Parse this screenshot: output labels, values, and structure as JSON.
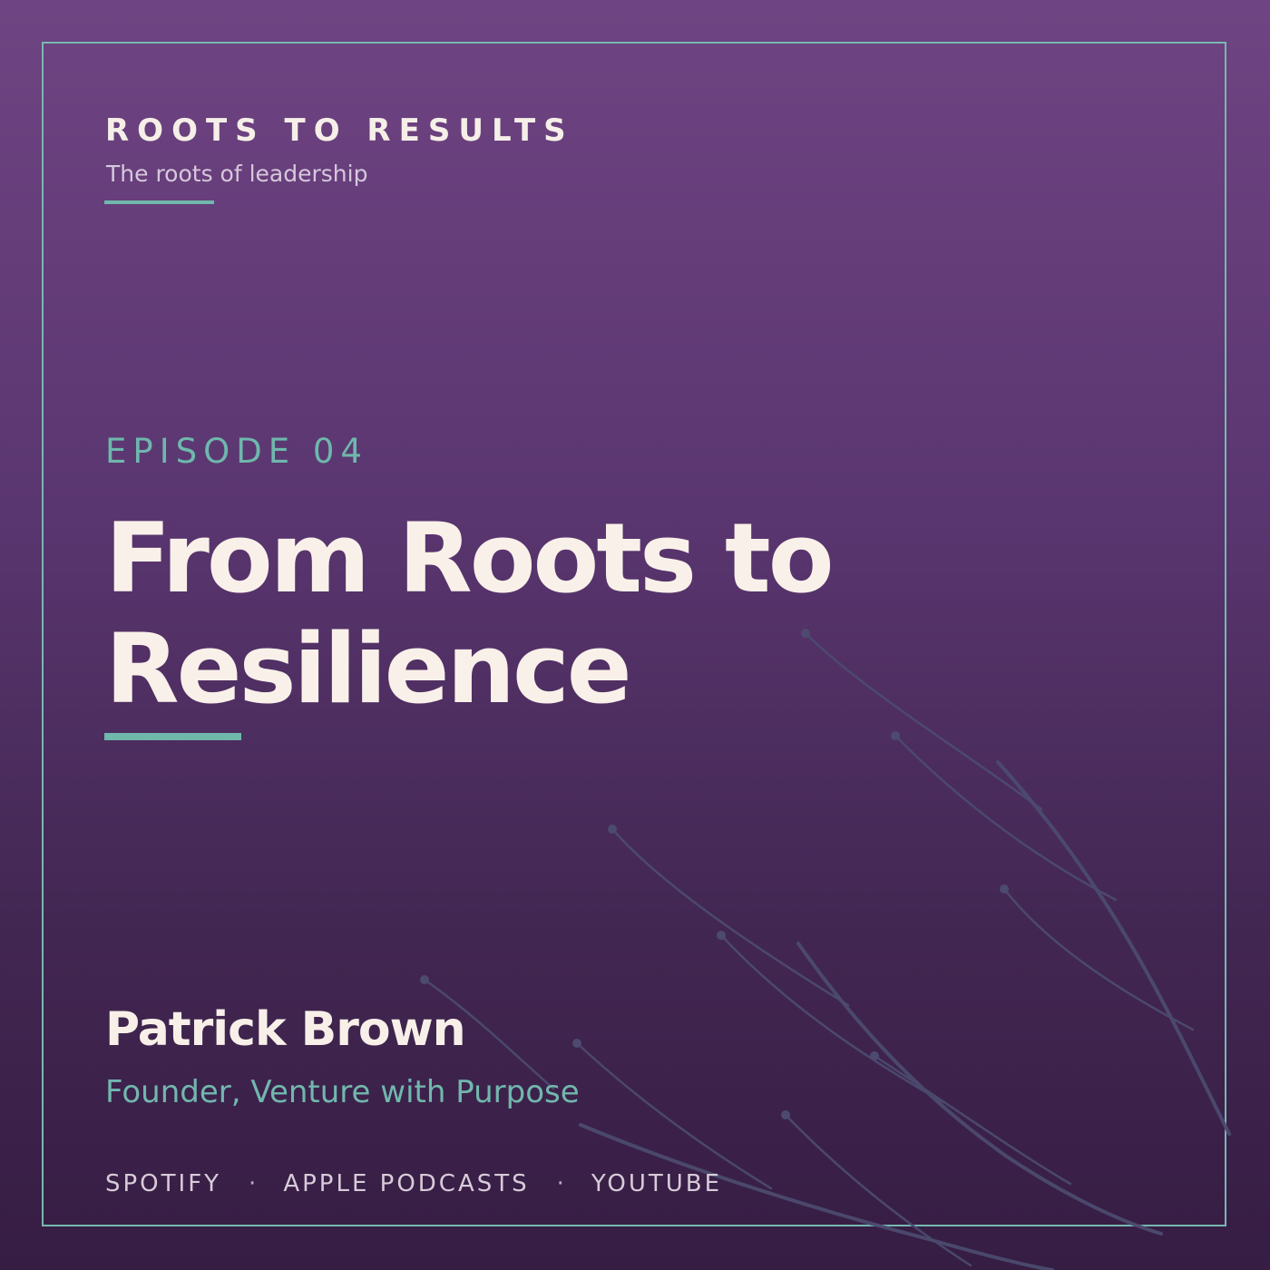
{
  "show": {
    "title": "ROOTS TO RESULTS",
    "tagline": "The roots of leadership"
  },
  "episode": {
    "label": "EPISODE 04",
    "title_line_1": "From Roots to",
    "title_line_2": "Resilience"
  },
  "guest": {
    "name": "Patrick Brown",
    "role": "Founder, Venture with Purpose"
  },
  "platforms": {
    "items": [
      "SPOTIFY",
      "APPLE PODCASTS",
      "YOUTUBE"
    ],
    "separator": "·"
  },
  "colors": {
    "background_top": "#6f4482",
    "background_bottom": "#361d43",
    "accent_teal": "#6fb8ab",
    "text_cream": "#f9f1e9",
    "root_lines": "#4b4c6d"
  }
}
